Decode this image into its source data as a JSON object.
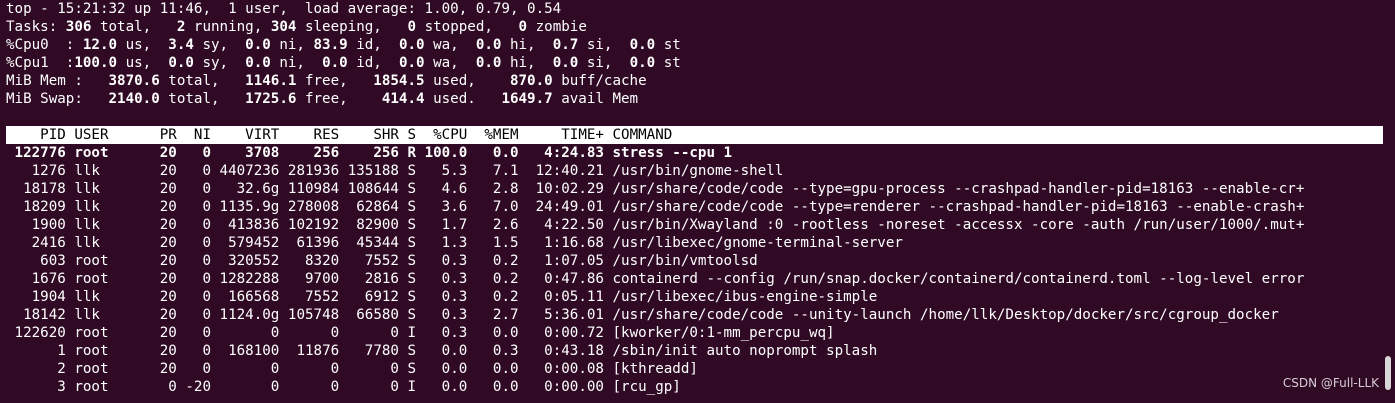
{
  "summary": {
    "uptime_line": {
      "pre": "top - 15:21:32 up 11:46,  1 user,  load average: 1.00, 0.79, 0.54"
    },
    "tasks_line": [
      {
        "t": "Tasks: ",
        "b": false
      },
      {
        "t": "306",
        "b": true
      },
      {
        "t": " total,   ",
        "b": false
      },
      {
        "t": "2",
        "b": true
      },
      {
        "t": " running, ",
        "b": false
      },
      {
        "t": "304",
        "b": true
      },
      {
        "t": " sleeping,   ",
        "b": false
      },
      {
        "t": "0",
        "b": true
      },
      {
        "t": " stopped,   ",
        "b": false
      },
      {
        "t": "0",
        "b": true
      },
      {
        "t": " zombie",
        "b": false
      }
    ],
    "cpu0_line": [
      {
        "t": "%Cpu0  : ",
        "b": false
      },
      {
        "t": "12.0",
        "b": true
      },
      {
        "t": " us,  ",
        "b": false
      },
      {
        "t": "3.4",
        "b": true
      },
      {
        "t": " sy,  ",
        "b": false
      },
      {
        "t": "0.0",
        "b": true
      },
      {
        "t": " ni, ",
        "b": false
      },
      {
        "t": "83.9",
        "b": true
      },
      {
        "t": " id,  ",
        "b": false
      },
      {
        "t": "0.0",
        "b": true
      },
      {
        "t": " wa,  ",
        "b": false
      },
      {
        "t": "0.0",
        "b": true
      },
      {
        "t": " hi,  ",
        "b": false
      },
      {
        "t": "0.7",
        "b": true
      },
      {
        "t": " si,  ",
        "b": false
      },
      {
        "t": "0.0",
        "b": true
      },
      {
        "t": " st",
        "b": false
      }
    ],
    "cpu1_line": [
      {
        "t": "%Cpu1  :",
        "b": false
      },
      {
        "t": "100.0",
        "b": true
      },
      {
        "t": " us,  ",
        "b": false
      },
      {
        "t": "0.0",
        "b": true
      },
      {
        "t": " sy,  ",
        "b": false
      },
      {
        "t": "0.0",
        "b": true
      },
      {
        "t": " ni,  ",
        "b": false
      },
      {
        "t": "0.0",
        "b": true
      },
      {
        "t": " id,  ",
        "b": false
      },
      {
        "t": "0.0",
        "b": true
      },
      {
        "t": " wa,  ",
        "b": false
      },
      {
        "t": "0.0",
        "b": true
      },
      {
        "t": " hi,  ",
        "b": false
      },
      {
        "t": "0.0",
        "b": true
      },
      {
        "t": " si,  ",
        "b": false
      },
      {
        "t": "0.0",
        "b": true
      },
      {
        "t": " st",
        "b": false
      }
    ],
    "mem_line": [
      {
        "t": "MiB Mem :   ",
        "b": false
      },
      {
        "t": "3870.6",
        "b": true
      },
      {
        "t": " total,   ",
        "b": false
      },
      {
        "t": "1146.1",
        "b": true
      },
      {
        "t": " free,   ",
        "b": false
      },
      {
        "t": "1854.5",
        "b": true
      },
      {
        "t": " used,    ",
        "b": false
      },
      {
        "t": "870.0",
        "b": true
      },
      {
        "t": " buff/cache",
        "b": false
      }
    ],
    "swap_line": [
      {
        "t": "MiB Swap:   ",
        "b": false
      },
      {
        "t": "2140.0",
        "b": true
      },
      {
        "t": " total,   ",
        "b": false
      },
      {
        "t": "1725.6",
        "b": true
      },
      {
        "t": " free,    ",
        "b": false
      },
      {
        "t": "414.4",
        "b": true
      },
      {
        "t": " used.   ",
        "b": false
      },
      {
        "t": "1649.7",
        "b": true
      },
      {
        "t": " avail Mem",
        "b": false
      }
    ]
  },
  "columns": [
    "PID",
    "USER",
    "PR",
    "NI",
    "VIRT",
    "RES",
    "SHR",
    "S",
    "%CPU",
    "%MEM",
    "TIME+",
    "COMMAND"
  ],
  "processes": [
    {
      "pid": "122776",
      "user": "root",
      "pr": "20",
      "ni": "0",
      "virt": "3708",
      "res": "256",
      "shr": "256",
      "s": "R",
      "cpu": "100.0",
      "mem": "0.0",
      "time": "4:24.83",
      "command": "stress --cpu 1",
      "bold": true
    },
    {
      "pid": "1276",
      "user": "llk",
      "pr": "20",
      "ni": "0",
      "virt": "4407236",
      "res": "281936",
      "shr": "135188",
      "s": "S",
      "cpu": "5.3",
      "mem": "7.1",
      "time": "12:40.21",
      "command": "/usr/bin/gnome-shell",
      "bold": false
    },
    {
      "pid": "18178",
      "user": "llk",
      "pr": "20",
      "ni": "0",
      "virt": "32.6g",
      "res": "110984",
      "shr": "108644",
      "s": "S",
      "cpu": "4.6",
      "mem": "2.8",
      "time": "10:02.29",
      "command": "/usr/share/code/code --type=gpu-process --crashpad-handler-pid=18163 --enable-cr+",
      "bold": false
    },
    {
      "pid": "18209",
      "user": "llk",
      "pr": "20",
      "ni": "0",
      "virt": "1135.9g",
      "res": "278008",
      "shr": "62864",
      "s": "S",
      "cpu": "3.6",
      "mem": "7.0",
      "time": "24:49.01",
      "command": "/usr/share/code/code --type=renderer --crashpad-handler-pid=18163 --enable-crash+",
      "bold": false
    },
    {
      "pid": "1900",
      "user": "llk",
      "pr": "20",
      "ni": "0",
      "virt": "413836",
      "res": "102192",
      "shr": "82900",
      "s": "S",
      "cpu": "1.7",
      "mem": "2.6",
      "time": "4:22.50",
      "command": "/usr/bin/Xwayland :0 -rootless -noreset -accessx -core -auth /run/user/1000/.mut+",
      "bold": false
    },
    {
      "pid": "2416",
      "user": "llk",
      "pr": "20",
      "ni": "0",
      "virt": "579452",
      "res": "61396",
      "shr": "45344",
      "s": "S",
      "cpu": "1.3",
      "mem": "1.5",
      "time": "1:16.68",
      "command": "/usr/libexec/gnome-terminal-server",
      "bold": false
    },
    {
      "pid": "603",
      "user": "root",
      "pr": "20",
      "ni": "0",
      "virt": "320552",
      "res": "8320",
      "shr": "7552",
      "s": "S",
      "cpu": "0.3",
      "mem": "0.2",
      "time": "1:07.05",
      "command": "/usr/bin/vmtoolsd",
      "bold": false
    },
    {
      "pid": "1676",
      "user": "root",
      "pr": "20",
      "ni": "0",
      "virt": "1282288",
      "res": "9700",
      "shr": "2816",
      "s": "S",
      "cpu": "0.3",
      "mem": "0.2",
      "time": "0:47.86",
      "command": "containerd --config /run/snap.docker/containerd/containerd.toml --log-level error",
      "bold": false
    },
    {
      "pid": "1904",
      "user": "llk",
      "pr": "20",
      "ni": "0",
      "virt": "166568",
      "res": "7552",
      "shr": "6912",
      "s": "S",
      "cpu": "0.3",
      "mem": "0.2",
      "time": "0:05.11",
      "command": "/usr/libexec/ibus-engine-simple",
      "bold": false
    },
    {
      "pid": "18142",
      "user": "llk",
      "pr": "20",
      "ni": "0",
      "virt": "1124.0g",
      "res": "105748",
      "shr": "66580",
      "s": "S",
      "cpu": "0.3",
      "mem": "2.7",
      "time": "5:36.01",
      "command": "/usr/share/code/code --unity-launch /home/llk/Desktop/docker/src/cgroup_docker",
      "bold": false
    },
    {
      "pid": "122620",
      "user": "root",
      "pr": "20",
      "ni": "0",
      "virt": "0",
      "res": "0",
      "shr": "0",
      "s": "I",
      "cpu": "0.3",
      "mem": "0.0",
      "time": "0:00.72",
      "command": "[kworker/0:1-mm_percpu_wq]",
      "bold": false
    },
    {
      "pid": "1",
      "user": "root",
      "pr": "20",
      "ni": "0",
      "virt": "168100",
      "res": "11876",
      "shr": "7780",
      "s": "S",
      "cpu": "0.0",
      "mem": "0.3",
      "time": "0:43.18",
      "command": "/sbin/init auto noprompt splash",
      "bold": false
    },
    {
      "pid": "2",
      "user": "root",
      "pr": "20",
      "ni": "0",
      "virt": "0",
      "res": "0",
      "shr": "0",
      "s": "S",
      "cpu": "0.0",
      "mem": "0.0",
      "time": "0:00.08",
      "command": "[kthreadd]",
      "bold": false
    },
    {
      "pid": "3",
      "user": "root",
      "pr": "0",
      "ni": "-20",
      "virt": "0",
      "res": "0",
      "shr": "0",
      "s": "I",
      "cpu": "0.0",
      "mem": "0.0",
      "time": "0:00.00",
      "command": "[rcu_gp]",
      "bold": false
    }
  ],
  "watermark": "CSDN @Full-LLK",
  "colors": {
    "background": "#300a24",
    "text": "#ffffff",
    "header_bg": "#ffffff",
    "header_text": "#000000"
  }
}
